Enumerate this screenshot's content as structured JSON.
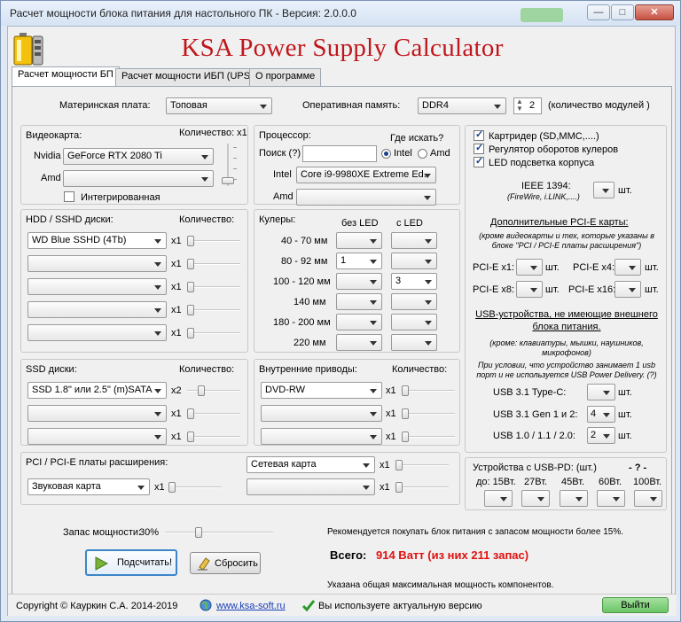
{
  "window": {
    "title": "Расчет мощности блока питания для настольного ПК - Версия: 2.0.0.0",
    "minimize": "—",
    "maximize": "□",
    "close": "✕"
  },
  "app_title": "KSA Power Supply Calculator",
  "tabs": [
    "Расчет мощности БП",
    "Расчет мощности ИБП (UPS)",
    "О программе"
  ],
  "top": {
    "motherboard_label": "Материнская плата:",
    "motherboard_value": "Топовая",
    "ram_label": "Оперативная память:",
    "ram_value": "DDR4",
    "ram_modules": "2",
    "ram_modules_label": "(количество модулей )"
  },
  "gpu": {
    "title": "Видеокарта:",
    "qty_label": "Количество: x1",
    "nvidia_label": "Nvidia",
    "nvidia_value": "GeForce RTX 2080 Ti",
    "amd_label": "Amd",
    "amd_value": "",
    "integrated_label": "Интегрированная"
  },
  "cpu": {
    "title": "Процессор:",
    "search_label": "Поиск (?)",
    "search_value": "",
    "where_label": "Где искать?",
    "intel_radio": "Intel",
    "amd_radio": "Amd",
    "intel_label": "Intel",
    "intel_value": "Core i9-9980XE Extreme Ed.",
    "amd_label": "Amd",
    "amd_value": ""
  },
  "hdd": {
    "title": "HDD / SSHD диски:",
    "qty_label": "Количество:",
    "rows": [
      {
        "value": "WD Blue SSHD (4Tb)",
        "mult": "x1"
      },
      {
        "value": "",
        "mult": "x1"
      },
      {
        "value": "",
        "mult": "x1"
      },
      {
        "value": "",
        "mult": "x1"
      },
      {
        "value": "",
        "mult": "x1"
      }
    ]
  },
  "coolers": {
    "title": "Кулеры:",
    "no_led": "без LED",
    "with_led": "с LED",
    "rows": [
      {
        "size": "40 - 70 мм",
        "a": "",
        "b": ""
      },
      {
        "size": "80 - 92 мм",
        "a": "1",
        "b": ""
      },
      {
        "size": "100 - 120 мм",
        "a": "",
        "b": "3"
      },
      {
        "size": "140 мм",
        "a": "",
        "b": ""
      },
      {
        "size": "180 - 200 мм",
        "a": "",
        "b": ""
      },
      {
        "size": "220 мм",
        "a": "",
        "b": ""
      }
    ]
  },
  "ssd": {
    "title": "SSD диски:",
    "qty_label": "Количество:",
    "rows": [
      {
        "value": "SSD 1.8\" или 2.5\" (m)SATA",
        "mult": "x2"
      },
      {
        "value": "",
        "mult": "x1"
      },
      {
        "value": "",
        "mult": "x1"
      }
    ]
  },
  "drives": {
    "title": "Внутренние приводы:",
    "qty_label": "Количество:",
    "rows": [
      {
        "value": "DVD-RW",
        "mult": "x1"
      },
      {
        "value": "",
        "mult": "x1"
      },
      {
        "value": "",
        "mult": "x1"
      }
    ]
  },
  "pci": {
    "title": "PCI / PCI-E платы расширения:",
    "card1": "Звуковая карта",
    "card1_mult": "x1",
    "card2": "Сетевая карта",
    "card2_mult": "x1",
    "card3": "",
    "card3_mult": "x1"
  },
  "right": {
    "checks": [
      {
        "label": "Картридер (SD,MMC,....)",
        "on": true
      },
      {
        "label": "Регулятор оборотов кулеров",
        "on": true
      },
      {
        "label": "LED подсветка корпуса",
        "on": true
      }
    ],
    "ieee_label": "IEEE 1394:",
    "ieee_sub": "(FireWire, i.LINK,....)",
    "unit": "шт.",
    "pcie_title": "Дополнительные PCI-E карты:",
    "pcie_note": "(кроме видеокарты и тех, которые указаны в блоке \"PCI / PCI-E платы расширения\")",
    "pcie_x1": "PCI-E x1:",
    "pcie_x4": "PCI-E x4:",
    "pcie_x8": "PCI-E x8:",
    "pcie_x16": "PCI-E x16:",
    "usb_title": "USB-устройства, не имеющие внешнего блока питания.",
    "usb_note1": "(кроме: клавиатуры, мышки, наушников, микрофонов)",
    "usb_note2": "При условии, что устройство занимает 1 usb порт и не используется USB Power Delivery. (?)",
    "usb_c_label": "USB 3.1 Type-C:",
    "usb_c_value": "",
    "usb31_label": "USB 3.1 Gen 1 и 2:",
    "usb31_value": "4",
    "usb2_label": "USB 1.0 / 1.1 / 2.0:",
    "usb2_value": "2",
    "pd_title": "Устройства с USB-PD:  (шт.)",
    "pd_q": "- ? -",
    "pd_cols": [
      "до: 15Вт.",
      "27Вт.",
      "45Вт.",
      "60Вт.",
      "100Вт."
    ]
  },
  "bottom": {
    "reserve_label": "Запас мощности:",
    "reserve_value": "30%",
    "reserve_fraction": 0.3,
    "recommend": "Рекомендуется покупать блок питания с запасом мощности более 15%.",
    "calc_btn": "Подсчитать!",
    "reset_btn": "Сбросить",
    "total_label": "Всего:",
    "total_value": "914 Ватт (из них 211 запас)",
    "note": "Указана общая максимальная мощность компонентов."
  },
  "status": {
    "copyright": "Copyright  © Кауркин С.А. 2014-2019",
    "site": "www.ksa-soft.ru",
    "update": "Вы используете актуальную версию",
    "exit": "Выйти"
  },
  "colors": {
    "title_red": "#c0161b",
    "total_red": "#e01010",
    "link": "#1a3fb8",
    "exit_green": "#7fd07a"
  }
}
